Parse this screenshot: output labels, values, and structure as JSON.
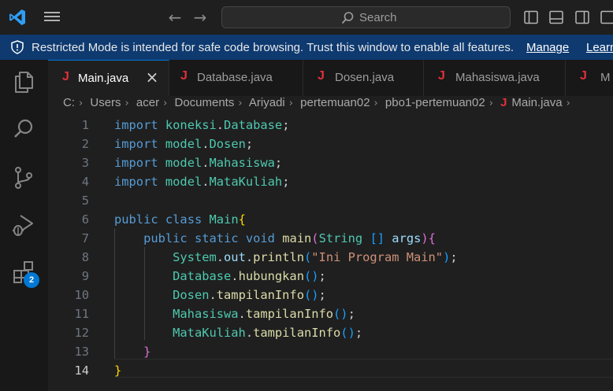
{
  "titlebar": {
    "search_placeholder": "Search"
  },
  "banner": {
    "text": "Restricted Mode is intended for safe code browsing. Trust this window to enable all features.",
    "manage_label": "Manage",
    "learn_label": "Learn"
  },
  "activity": {
    "extensions_badge": "2"
  },
  "tabs": [
    {
      "label": "Main.java",
      "active": true
    },
    {
      "label": "Database.java"
    },
    {
      "label": "Dosen.java"
    },
    {
      "label": "Mahasiswa.java"
    },
    {
      "label": "M"
    }
  ],
  "tab_icon_glyph": "J",
  "breadcrumb": [
    "C:",
    "Users",
    "acer",
    "Documents",
    "Ariyadi",
    "pertemuan02",
    "pbo1-pertemuan02",
    "Main.java"
  ],
  "editor": {
    "line_numbers": [
      "1",
      "2",
      "3",
      "4",
      "5",
      "6",
      "7",
      "8",
      "9",
      "10",
      "11",
      "12",
      "13",
      "14"
    ],
    "current_line": "14",
    "lines": [
      [
        {
          "t": "import",
          "c": "kw"
        },
        {
          "t": " "
        },
        {
          "t": "koneksi",
          "c": "ns"
        },
        {
          "t": "."
        },
        {
          "t": "Database",
          "c": "cls"
        },
        {
          "t": ";"
        }
      ],
      [
        {
          "t": "import",
          "c": "kw"
        },
        {
          "t": " "
        },
        {
          "t": "model",
          "c": "ns"
        },
        {
          "t": "."
        },
        {
          "t": "Dosen",
          "c": "cls"
        },
        {
          "t": ";"
        }
      ],
      [
        {
          "t": "import",
          "c": "kw"
        },
        {
          "t": " "
        },
        {
          "t": "model",
          "c": "ns"
        },
        {
          "t": "."
        },
        {
          "t": "Mahasiswa",
          "c": "cls"
        },
        {
          "t": ";"
        }
      ],
      [
        {
          "t": "import",
          "c": "kw"
        },
        {
          "t": " "
        },
        {
          "t": "model",
          "c": "ns"
        },
        {
          "t": "."
        },
        {
          "t": "MataKuliah",
          "c": "cls"
        },
        {
          "t": ";"
        }
      ],
      [],
      [
        {
          "t": "public",
          "c": "kw"
        },
        {
          "t": " "
        },
        {
          "t": "class",
          "c": "kw"
        },
        {
          "t": " "
        },
        {
          "t": "Main",
          "c": "cls"
        },
        {
          "t": "{",
          "c": "b1"
        }
      ],
      [
        {
          "t": "    "
        },
        {
          "t": "public",
          "c": "kw"
        },
        {
          "t": " "
        },
        {
          "t": "static",
          "c": "kw"
        },
        {
          "t": " "
        },
        {
          "t": "void",
          "c": "kw"
        },
        {
          "t": " "
        },
        {
          "t": "main",
          "c": "fn"
        },
        {
          "t": "(",
          "c": "b2"
        },
        {
          "t": "String",
          "c": "cls"
        },
        {
          "t": " "
        },
        {
          "t": "[]",
          "c": "b3"
        },
        {
          "t": " "
        },
        {
          "t": "args",
          "c": "var"
        },
        {
          "t": ")",
          "c": "b2"
        },
        {
          "t": "{",
          "c": "b2"
        }
      ],
      [
        {
          "t": "        "
        },
        {
          "t": "System",
          "c": "cls"
        },
        {
          "t": "."
        },
        {
          "t": "out",
          "c": "var"
        },
        {
          "t": "."
        },
        {
          "t": "println",
          "c": "fn"
        },
        {
          "t": "(",
          "c": "b3"
        },
        {
          "t": "\"Ini Program Main\"",
          "c": "str"
        },
        {
          "t": ")",
          "c": "b3"
        },
        {
          "t": ";"
        }
      ],
      [
        {
          "t": "        "
        },
        {
          "t": "Database",
          "c": "cls"
        },
        {
          "t": "."
        },
        {
          "t": "hubungkan",
          "c": "fn"
        },
        {
          "t": "()",
          "c": "b3"
        },
        {
          "t": ";"
        }
      ],
      [
        {
          "t": "        "
        },
        {
          "t": "Dosen",
          "c": "cls"
        },
        {
          "t": "."
        },
        {
          "t": "tampilanInfo",
          "c": "fn"
        },
        {
          "t": "()",
          "c": "b3"
        },
        {
          "t": ";"
        }
      ],
      [
        {
          "t": "        "
        },
        {
          "t": "Mahasiswa",
          "c": "cls"
        },
        {
          "t": "."
        },
        {
          "t": "tampilanInfo",
          "c": "fn"
        },
        {
          "t": "()",
          "c": "b3"
        },
        {
          "t": ";"
        }
      ],
      [
        {
          "t": "        "
        },
        {
          "t": "MataKuliah",
          "c": "cls"
        },
        {
          "t": "."
        },
        {
          "t": "tampilanInfo",
          "c": "fn"
        },
        {
          "t": "()",
          "c": "b3"
        },
        {
          "t": ";"
        }
      ],
      [
        {
          "t": "    "
        },
        {
          "t": "}",
          "c": "b2"
        }
      ],
      [
        {
          "t": "}",
          "c": "b1"
        }
      ]
    ]
  }
}
